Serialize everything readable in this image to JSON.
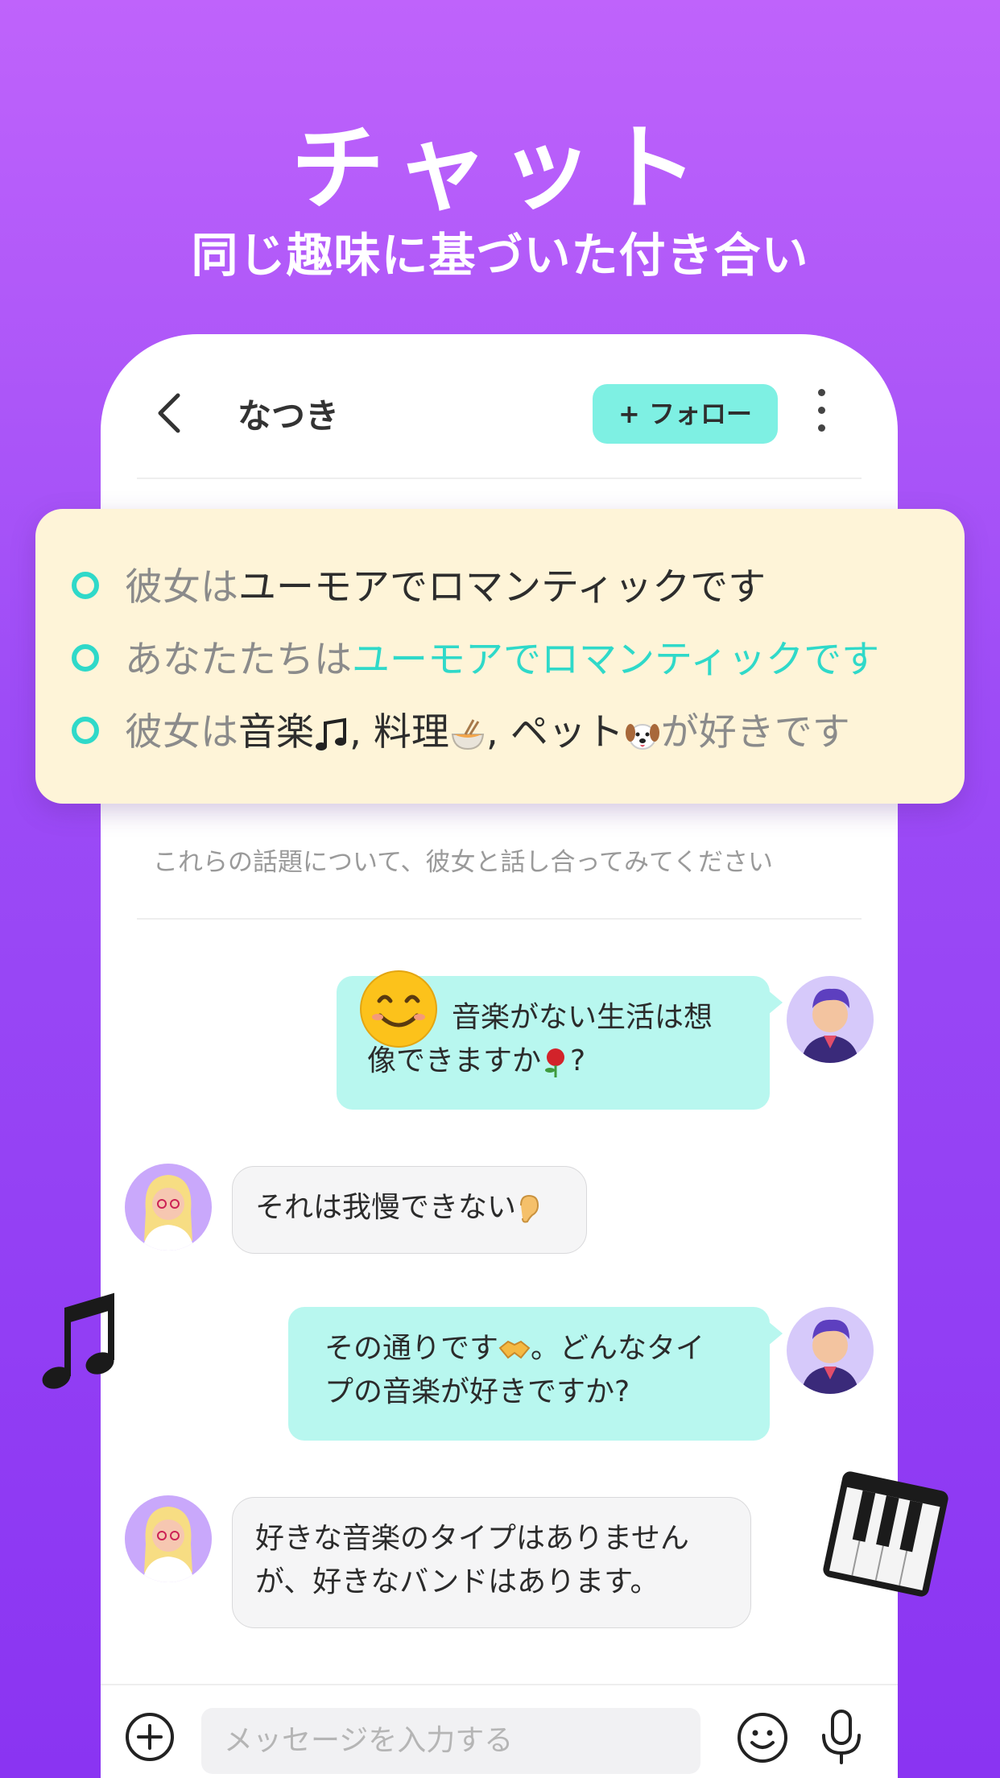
{
  "hero": {
    "title": "チャット",
    "subtitle": "同じ趣味に基づいた付き合い"
  },
  "chat_header": {
    "name": "なつき",
    "follow_label": "+ フォロー"
  },
  "card": {
    "row1": {
      "gray": "彼女は",
      "dark": "ユーモアでロマンティックです"
    },
    "row2": {
      "gray": "あなたたちは",
      "teal": "ユーモアでロマンティックです"
    },
    "row3": {
      "gray": "彼女は",
      "dark1": "音楽",
      "sep1": ", 料理",
      "sep2": ", ペット",
      "tail": "が好きです"
    }
  },
  "hint": "これらの話題について、彼女と話し合ってみてください",
  "messages": [
    {
      "from": "me",
      "text_a": "音楽がない生活は想",
      "text_b": "像できますか",
      "text_c": "?"
    },
    {
      "from": "her",
      "text": "それは我慢できない"
    },
    {
      "from": "me",
      "text_a": "その通りです",
      "text_b": "。どんなタイ",
      "text_c": "プの音楽が好きですか?"
    },
    {
      "from": "her",
      "text_a": "好きな音楽のタイプはありません",
      "text_b": "が、好きなバンドはあります。"
    }
  ],
  "input": {
    "placeholder": "メッセージを入力する"
  },
  "icons": [
    "back-icon",
    "more-icon",
    "plus-circle-icon",
    "emoji-icon",
    "mic-icon",
    "music-note-icon",
    "piano-icon"
  ],
  "colors": {
    "accent_teal": "#2fd9c9",
    "follow_bg": "#7ef0e3",
    "bubble_me": "#b8f7ef",
    "card_bg": "#fef4d8",
    "bg_purple": "#9d4cf6"
  }
}
